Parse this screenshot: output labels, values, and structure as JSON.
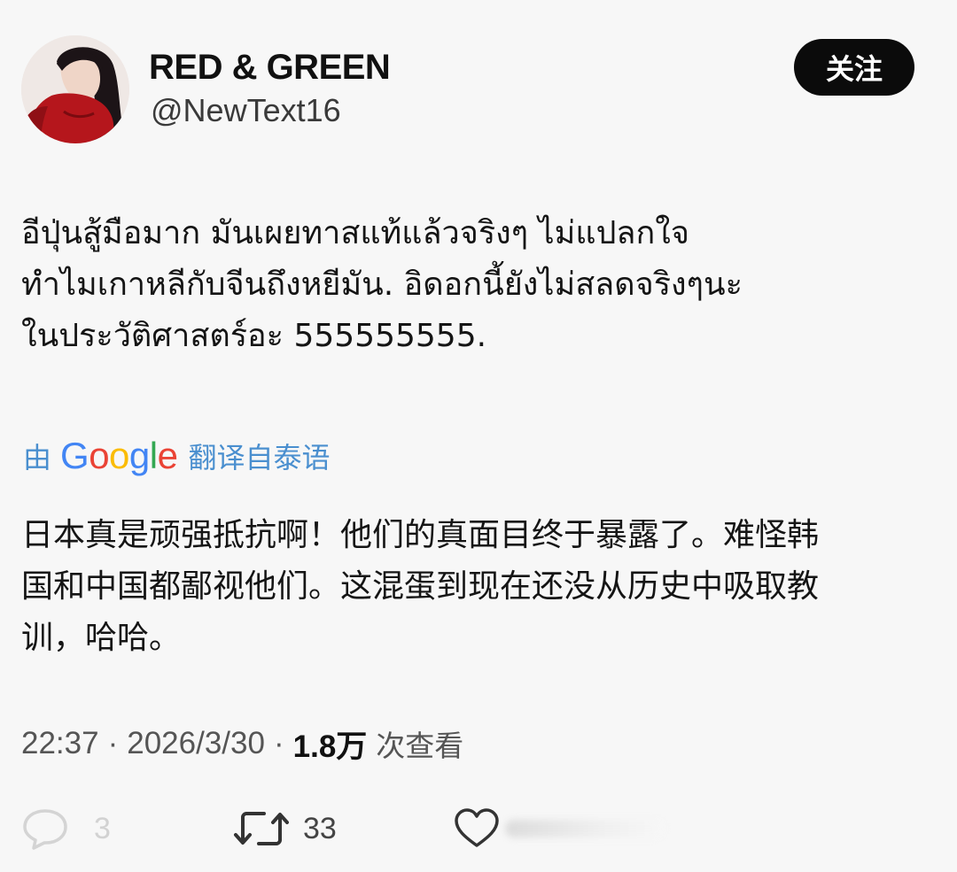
{
  "author": {
    "display_name": "RED & GREEN",
    "handle": "@NewText16"
  },
  "follow_button": {
    "label": "关注"
  },
  "tweet": {
    "original_lines": [
      "อีปุ่นสู้มือมาก มันเผยทาสแท้แล้วจริงๆ ไม่แปลกใจ",
      "ทำไมเกาหลีกับจีนถึงหยีมัน. อิดอกนี้ยังไม่สลดจริงๆนะ",
      "ในประวัติศาสตร์อะ 555555555."
    ],
    "translation_prefix": "由",
    "translation_logo_text": "Google",
    "translation_suffix": "翻译自泰语",
    "translated_lines": [
      "日本真是顽强抵抗啊！他们的真面目终于暴露了。难怪韩",
      "国和中国都鄙视他们。这混蛋到现在还没从历史中吸取教",
      "训，哈哈。"
    ]
  },
  "meta": {
    "time": "22:37",
    "separator": "·",
    "date": "2026/3/30",
    "views_count": "1.8万",
    "views_label": "次查看"
  },
  "actions": {
    "reply_count": "3",
    "retweet_count": "33"
  },
  "colors": {
    "background": "#f7f7f7",
    "follow_button_bg": "#0b0b0b",
    "translate_link": "#4a8fcf",
    "google_blue": "#4285f4",
    "google_red": "#ea4335",
    "google_yellow": "#fbbc05",
    "google_green": "#34a853"
  }
}
